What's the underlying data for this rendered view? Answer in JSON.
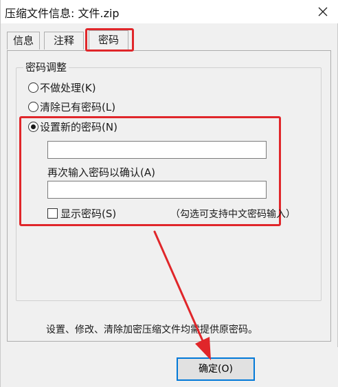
{
  "window": {
    "title": "压缩文件信息: 文件.zip"
  },
  "tabs": [
    {
      "label": "信息",
      "active": false
    },
    {
      "label": "注释",
      "active": false
    },
    {
      "label": "密码",
      "active": true
    }
  ],
  "password_group": {
    "legend": "密码调整",
    "options": [
      {
        "label": "不做处理(K)",
        "checked": false
      },
      {
        "label": "清除已有密码(L)",
        "checked": false
      },
      {
        "label": "设置新的密码(N)",
        "checked": true
      }
    ],
    "password_value": "",
    "confirm_label": "再次输入密码以确认(A)",
    "confirm_value": "",
    "show_password_label": "显示密码(S)",
    "show_password_checked": false,
    "hint": "（勾选可支持中文密码输入）"
  },
  "footer": {
    "description": "设置、修改、清除加密压缩文件均需提供原密码。"
  },
  "buttons": {
    "ok_label": "确定(O)"
  },
  "colors": {
    "highlight_red": "#e0262a",
    "focus_blue": "#0078d7"
  },
  "icons": {
    "close": "close-icon"
  }
}
